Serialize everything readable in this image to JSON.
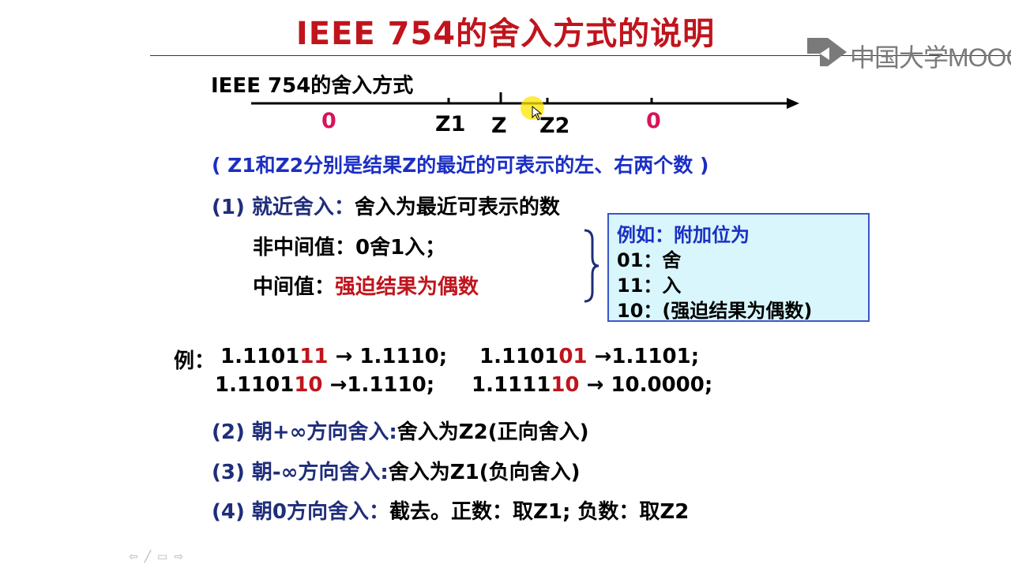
{
  "title": "IEEE 754的舍入方式的说明",
  "logo": {
    "text": "中国大学MOOC",
    "icon": "mooc-play-icon"
  },
  "axis": {
    "heading": "IEEE 754的舍入方式",
    "labels": [
      "0",
      "Z1",
      "Z",
      "Z2",
      "0"
    ]
  },
  "explain": "( Z1和Z2分别是结果Z的最近的可表示的左、右两个数 )",
  "items": {
    "one_prefix": "(1) 就近舍入：",
    "one_body": "舍入为最近可表示的数",
    "non_mid": "非中间值：0舍1入；",
    "mid_prefix": "中间值：",
    "mid_body": "强迫结果为偶数"
  },
  "note": {
    "heading": "例如：附加位为",
    "lines": [
      "01：舍",
      "11：入",
      "10：(强迫结果为偶数)"
    ]
  },
  "examples": {
    "prefix": "例：",
    "row1": [
      {
        "a": "1.1101",
        "b": "11",
        "c": " → 1.1110;"
      },
      {
        "a": "1.1101",
        "b": "01",
        "c": " →1.1101;"
      }
    ],
    "row2": [
      {
        "a": "1.1101",
        "b": "10",
        "c": " →1.1110;"
      },
      {
        "a": "1.1111",
        "b": "10",
        "c": " → 10.0000;"
      }
    ]
  },
  "modes": [
    {
      "prefix": "(2) 朝+∞方向舍入:",
      "body": "舍入为Z2(正向舍入)"
    },
    {
      "prefix": "(3) 朝-∞方向舍入:",
      "body": "舍入为Z1(负向舍入)"
    },
    {
      "prefix": "(4) 朝0方向舍入：",
      "body": "截去。正数：取Z1;  负数：取Z2"
    }
  ],
  "nav": [
    "⇦",
    "╱",
    "▭",
    "⇨"
  ],
  "colors": {
    "title": "#c0141c",
    "navy": "#1f2e7a",
    "blue": "#1b2fc4",
    "box_bg": "#d8f6fb",
    "zero": "#d6145a"
  }
}
